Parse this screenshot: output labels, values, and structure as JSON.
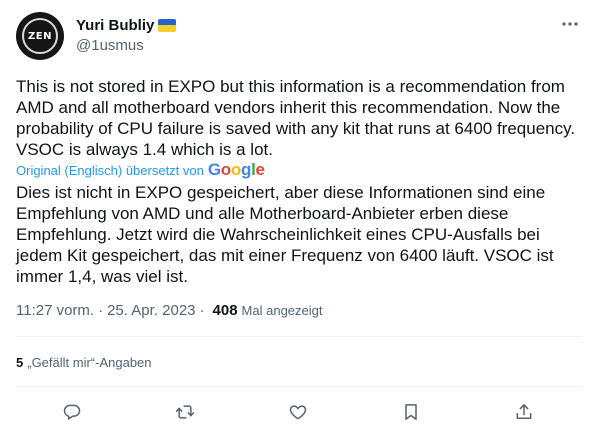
{
  "author": {
    "name": "Yuri Bubliy",
    "handle": "@1usmus",
    "avatar_text": "ZEN",
    "flag_icon": "ukraine-flag-icon",
    "flag_colors": [
      "#2a62c9",
      "#f7cf2c"
    ]
  },
  "tweet": {
    "text_original": "This is not stored in EXPO but this information is a recommendation from AMD and all motherboard vendors inherit this recommendation. Now the probability of CPU failure is saved with any kit that runs at 6400 frequency. VSOC is always 1.4 which is a lot.",
    "translation_note": "Original (Englisch) übersetzt von",
    "translator_logo": "Google",
    "text_translated": "Dies ist nicht in EXPO gespeichert, aber diese Informationen sind eine Empfehlung von AMD und alle Motherboard-Anbieter erben diese Empfehlung. Jetzt wird die Wahrscheinlichkeit eines CPU-Ausfalls bei jedem Kit gespeichert, das mit einer Frequenz von 6400 läuft. VSOC ist immer 1,4, was viel ist."
  },
  "meta": {
    "time": "11:27 vorm.",
    "separator": "·",
    "date": "25. Apr. 2023",
    "views_count": "408",
    "views_label": "Mal angezeigt"
  },
  "engagement": {
    "likes_count": "5",
    "likes_label": "„Gefällt mir“-Angaben"
  },
  "actions": [
    {
      "icon": "reply-icon"
    },
    {
      "icon": "retweet-icon"
    },
    {
      "icon": "like-icon"
    },
    {
      "icon": "bookmark-icon"
    },
    {
      "icon": "share-icon"
    }
  ],
  "colors": {
    "text": "#0f1419",
    "secondary": "#536471",
    "link": "#1d9bf0",
    "divider": "#eff3f4"
  }
}
